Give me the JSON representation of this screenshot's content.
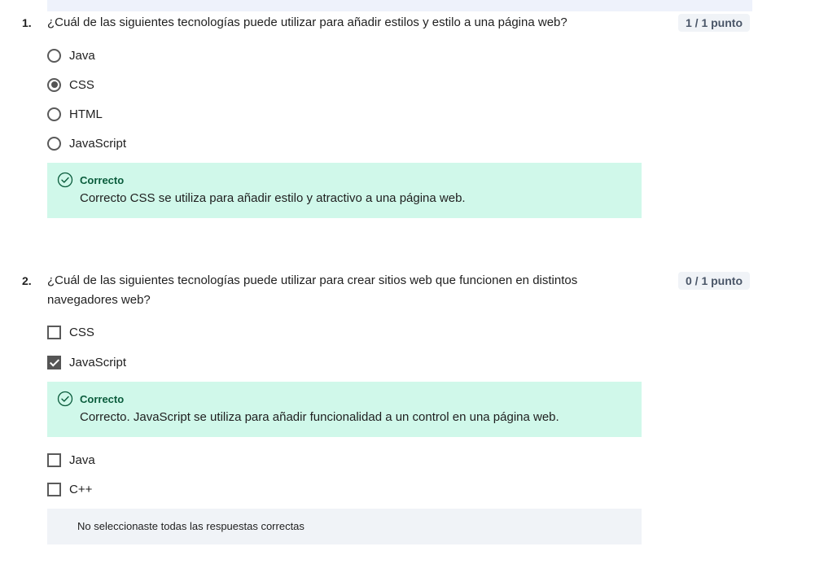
{
  "q1": {
    "number": "1.",
    "text": "¿Cuál de las siguientes tecnologías puede utilizar para añadir estilos y estilo a una página web?",
    "score": "1 / 1 punto",
    "options": [
      {
        "label": "Java",
        "selected": false
      },
      {
        "label": "CSS",
        "selected": true
      },
      {
        "label": "HTML",
        "selected": false
      },
      {
        "label": "JavaScript",
        "selected": false
      }
    ],
    "feedback": {
      "title": "Correcto",
      "text": "Correcto CSS se utiliza para añadir estilo y atractivo a una página web."
    }
  },
  "q2": {
    "number": "2.",
    "text": "¿Cuál de las siguientes tecnologías puede utilizar para crear sitios web que funcionen en distintos navegadores web?",
    "score": "0 / 1 punto",
    "options": [
      {
        "label": "CSS",
        "selected": false
      },
      {
        "label": "JavaScript",
        "selected": true
      },
      {
        "label": "Java",
        "selected": false
      },
      {
        "label": "C++",
        "selected": false
      }
    ],
    "feedback": {
      "title": "Correcto",
      "text": "Correcto. JavaScript se utiliza para añadir funcionalidad a un control en una página web."
    },
    "note": "No seleccionaste todas las respuestas correctas"
  },
  "colors": {
    "correct_bg": "#d0f8ea",
    "correct_accent": "#0a5c3c",
    "score_bg": "#f0f3f7",
    "note_bg": "#f0f3f7"
  }
}
